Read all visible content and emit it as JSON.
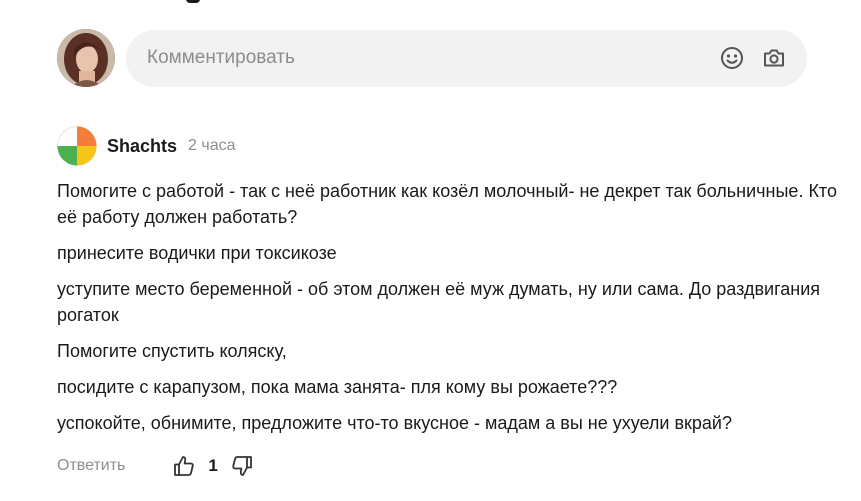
{
  "composer": {
    "placeholder": "Комментировать",
    "icons": [
      "emoji-icon",
      "camera-icon"
    ]
  },
  "comment": {
    "author": "Shachts",
    "time": "2 часа",
    "paragraphs": [
      "Помогите с работой - так с неё работник как козёл молочный- не декрет так больничные. Кто её работу должен работать?",
      "принесите водички при токсикозе",
      "уступите место беременной - об этом должен её муж думать, ну или сама. До раздвигания рогаток",
      "Помогите спустить коляску,",
      "посидите с карапузом, пока мама занята- пля кому вы рожаете???",
      "успокойте, обнимите, предложите что-то вкусное - мадам а вы не ухуели вкрай?"
    ],
    "reply_label": "Ответить",
    "likes": "1"
  },
  "colors": {
    "input_bg": "#f2f2f2",
    "muted_text": "#8e8e8e",
    "avatar_segments": [
      "#f27e3a",
      "#f5c518",
      "#4caf50",
      "#ffffff"
    ]
  }
}
